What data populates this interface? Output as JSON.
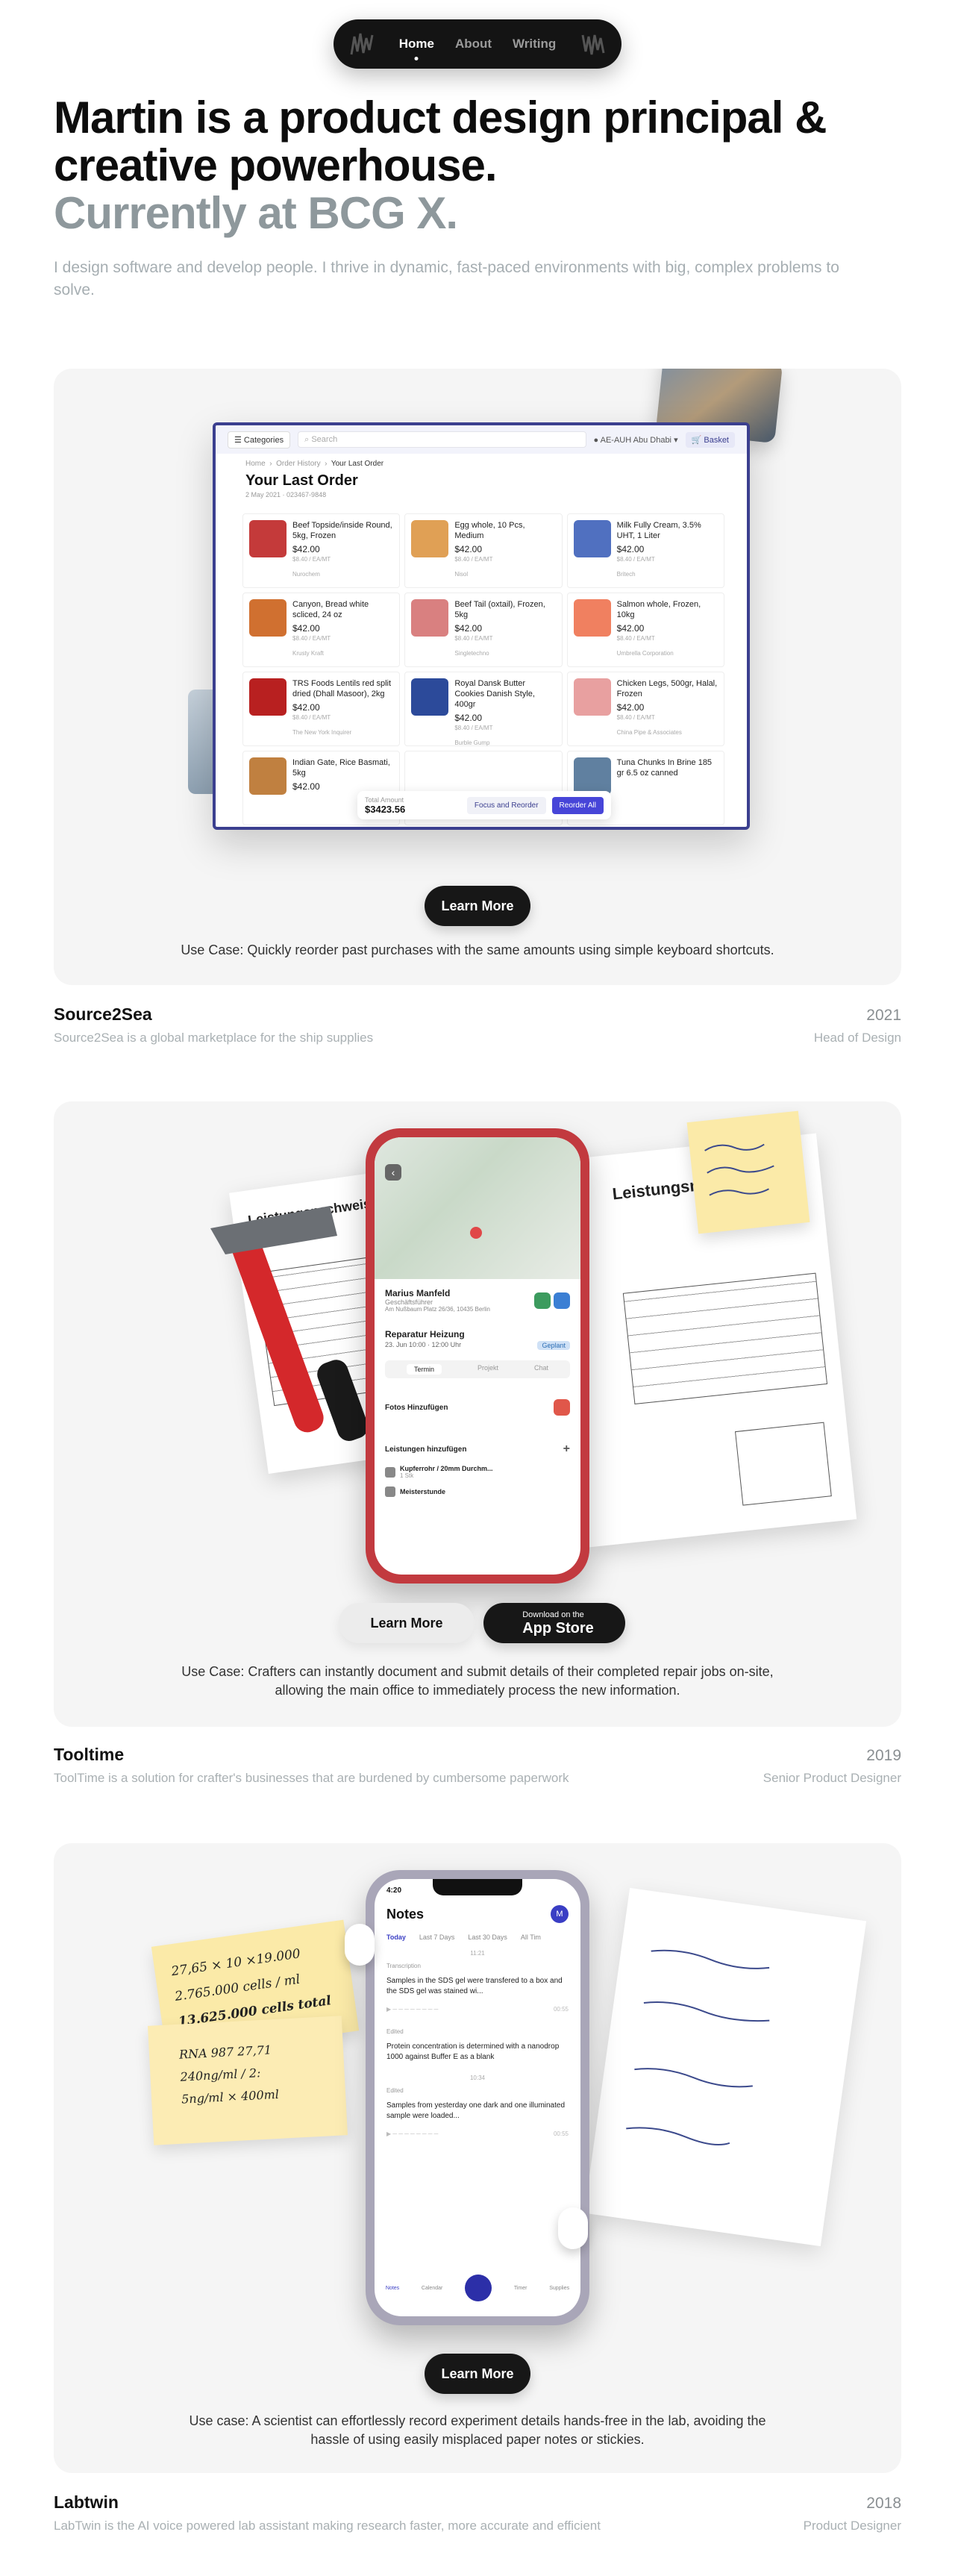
{
  "nav": {
    "links": [
      "Home",
      "About",
      "Writing"
    ],
    "active": "Home"
  },
  "hero": {
    "headline_line1": "Martin is a product design principal &",
    "headline_line2": "creative powerhouse.",
    "headline_sub": "Currently at BCG X.",
    "intro": "I design software and develop people. I thrive in dynamic, fast-paced environments with big, complex problems to solve."
  },
  "projects": [
    {
      "name": "Source2Sea",
      "year": "2021",
      "description": "Source2Sea is a global marketplace for the ship supplies",
      "role": "Head of Design",
      "use_case": "Use Case: Quickly reorder past purchases with the same amounts using simple keyboard shortcuts.",
      "cta": "Learn More",
      "app": {
        "categories_btn": "Categories",
        "search_placeholder": "Search",
        "location": "AE-AUH Abu Dhabi",
        "basket": "Basket",
        "breadcrumb": [
          "Home",
          "Order History",
          "Your Last Order"
        ],
        "title": "Your Last Order",
        "date": "2 May 2021 · 023467-9848",
        "products": [
          {
            "name": "Beef Topside/inside Round, 5kg, Frozen",
            "price": "$42.00",
            "unit": "$8.40 / EA/MT",
            "supplier": "Nurochem"
          },
          {
            "name": "Egg whole, 10 Pcs, Medium",
            "price": "$42.00",
            "unit": "$8.40 / EA/MT",
            "supplier": "Nisol"
          },
          {
            "name": "Milk Fully Cream, 3.5% UHT, 1 Liter",
            "price": "$42.00",
            "unit": "$8.40 / EA/MT",
            "supplier": "Britech"
          },
          {
            "name": "Canyon, Bread white scliced, 24 oz",
            "price": "$42.00",
            "unit": "$8.40 / EA/MT",
            "supplier": "Krusty Kraft"
          },
          {
            "name": "Beef Tail (oxtail), Frozen, 5kg",
            "price": "$42.00",
            "unit": "$8.40 / EA/MT",
            "supplier": "Singletechno"
          },
          {
            "name": "Salmon whole, Frozen, 10kg",
            "price": "$42.00",
            "unit": "$8.40 / EA/MT",
            "supplier": "Umbrella Corporation"
          },
          {
            "name": "TRS Foods Lentils red split dried (Dhall Masoor), 2kg",
            "price": "$42.00",
            "unit": "$8.40 / EA/MT",
            "supplier": "The New York Inquirer"
          },
          {
            "name": "Royal Dansk Butter Cookies Danish Style, 400gr",
            "price": "$42.00",
            "unit": "$8.40 / EA/MT",
            "supplier": "Burble Gump"
          },
          {
            "name": "Chicken Legs, 500gr, Halal, Frozen",
            "price": "$42.00",
            "unit": "$8.40 / EA/MT",
            "supplier": "China Pipe & Associates"
          },
          {
            "name": "Indian Gate, Rice Basmati, 5kg",
            "price": "$42.00",
            "unit": "",
            "supplier": ""
          },
          {
            "name": "",
            "price": "",
            "unit": "",
            "supplier": ""
          },
          {
            "name": "Tuna Chunks In Brine 185 gr 6.5 oz canned",
            "price": "",
            "unit": "",
            "supplier": ""
          }
        ],
        "total_label": "Total Amount",
        "total": "$3423.56",
        "focus_btn": "Focus and Reorder",
        "reorder_btn": "Reorder All"
      }
    },
    {
      "name": "Tooltime",
      "year": "2019",
      "description": "ToolTime is a solution for crafter's businesses that are burdened by cumbersome paperwork",
      "role": "Senior Product Designer",
      "use_case_line1": "Use Case: Crafters can instantly document and submit details of their completed repair jobs on-site,",
      "use_case_line2": "allowing the main office to immediately process the new information.",
      "cta": "Learn More",
      "app_store_small": "Download on the",
      "app_store_big": "App Store",
      "app": {
        "contact_name": "Marius Manfeld",
        "contact_role": "Geschäftsführer",
        "contact_addr": "Am Nußbaum Platz 26/36, 10435 Berlin",
        "job_title": "Reparatur Heizung",
        "job_date": "23. Jun 10:00 · 12:00 Uhr",
        "job_badge": "Geplant",
        "tabs": [
          "Termin",
          "Projekt",
          "Chat"
        ],
        "photos_label": "Fotos Hinzufügen",
        "services_label": "Leistungen hinzufügen",
        "service_1": "Kupferrohr / 20mm Durchm...",
        "service_1_qty": "1 Stk",
        "service_2": "Meisterstunde"
      },
      "paper_title": "Leistungsnachweis"
    },
    {
      "name": "Labtwin",
      "year": "2018",
      "description": "LabTwin is the AI voice powered lab assistant making research faster, more accurate and efficient",
      "role": "Product Designer",
      "use_case_line1": "Use case: A scientist can effortlessly record experiment details hands-free in the lab, avoiding the",
      "use_case_line2": "hassle of using easily misplaced paper notes or stickies.",
      "cta": "Learn More",
      "app": {
        "time": "4:20",
        "title": "Notes",
        "avatar": "M",
        "filters": [
          "Today",
          "Last 7 Days",
          "Last 30 Days",
          "All Tim"
        ],
        "time_1": "11:21",
        "note_1_type": "Transcription",
        "note_1": "Samples in the SDS gel were transfered to a box and the SDS gel was stained wi...",
        "note_1_dur": "00:55",
        "note_2_type": "Edited",
        "note_2": "Protein concentration is determined with a nanodrop 1000 against Buffer E as a blank",
        "time_2": "10:34",
        "note_3_type": "Edited",
        "note_3": "Samples from yesterday one dark and one illuminated sample were loaded...",
        "note_3_dur": "00:55",
        "tabbar": [
          "Notes",
          "Calendar",
          "",
          "Timer",
          "Supplies"
        ]
      },
      "sticky_1": [
        "27,65 × 10 ×19.000",
        "2.765.000 cells / ml",
        "13.625.000 cells total"
      ],
      "sticky_2": [
        "RNA 987 27,71",
        "240ng/ml / 2:",
        "5ng/ml × 400ml"
      ]
    }
  ],
  "colors": {
    "brand_accent": "#3b3f8f",
    "reorder_button": "#4745d8",
    "card_background": "#f5f5f5",
    "muted_text": "#a9b0b3"
  }
}
